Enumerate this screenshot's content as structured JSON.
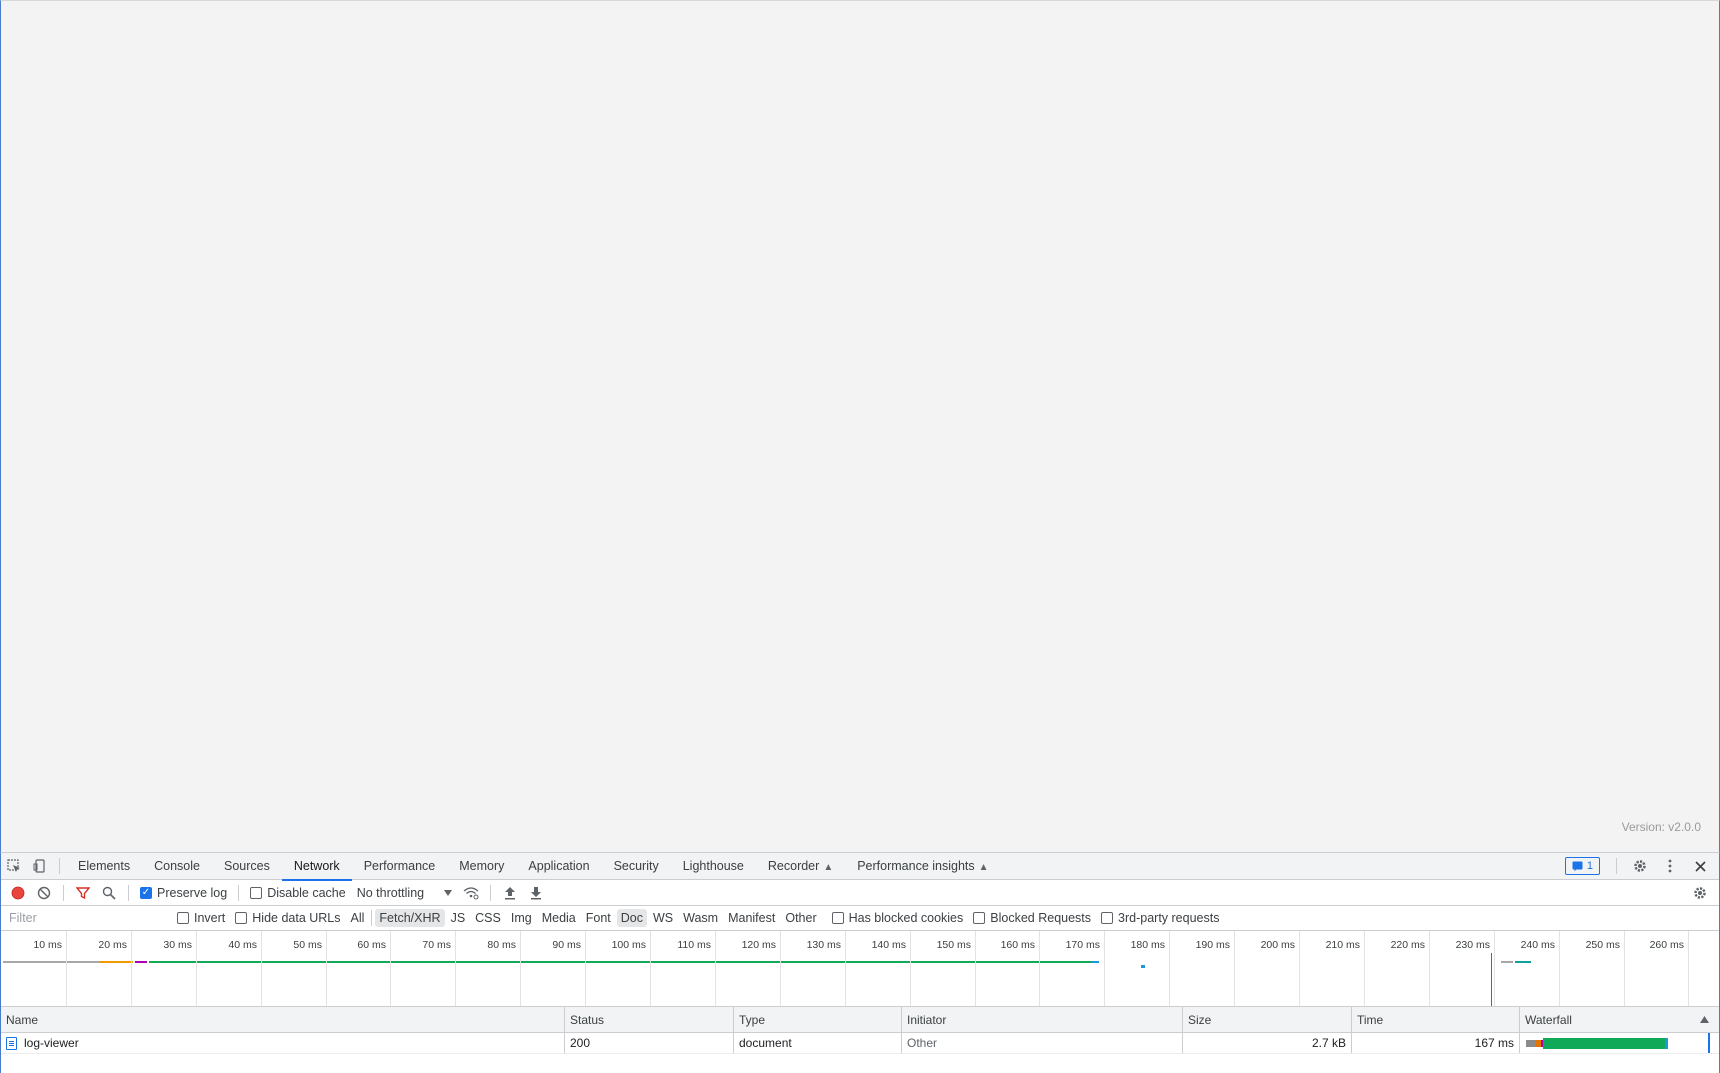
{
  "page": {
    "version": "Version: v2.0.0"
  },
  "devtools": {
    "tabs": [
      "Elements",
      "Console",
      "Sources",
      "Network",
      "Performance",
      "Memory",
      "Application",
      "Security",
      "Lighthouse",
      "Recorder",
      "Performance insights"
    ],
    "active_tab": "Network",
    "issues_count": "1"
  },
  "toolbar": {
    "preserve_log": "Preserve log",
    "disable_cache": "Disable cache",
    "throttling": "No throttling"
  },
  "filter": {
    "placeholder": "Filter",
    "invert": "Invert",
    "hide_data_urls": "Hide data URLs",
    "types": [
      "All",
      "Fetch/XHR",
      "JS",
      "CSS",
      "Img",
      "Media",
      "Font",
      "Doc",
      "WS",
      "Wasm",
      "Manifest",
      "Other"
    ],
    "selected_types": [
      "Fetch/XHR",
      "Doc"
    ],
    "has_blocked_cookies": "Has blocked cookies",
    "blocked_requests": "Blocked Requests",
    "third_party": "3rd-party requests"
  },
  "overview": {
    "ticks": [
      "10 ms",
      "20 ms",
      "30 ms",
      "40 ms",
      "50 ms",
      "60 ms",
      "70 ms",
      "80 ms",
      "90 ms",
      "100 ms",
      "110 ms",
      "120 ms",
      "130 ms",
      "140 ms",
      "150 ms",
      "160 ms",
      "170 ms",
      "180 ms",
      "190 ms",
      "200 ms",
      "210 ms",
      "220 ms",
      "230 ms",
      "240 ms",
      "250 ms",
      "260 ms"
    ]
  },
  "grid": {
    "headers": {
      "name": "Name",
      "status": "Status",
      "type": "Type",
      "initiator": "Initiator",
      "size": "Size",
      "time": "Time",
      "waterfall": "Waterfall"
    },
    "rows": [
      {
        "name": "log-viewer",
        "status": "200",
        "type": "document",
        "initiator": "Other",
        "size": "2.7 kB",
        "time": "167 ms"
      }
    ]
  },
  "colors": {
    "accent": "#1a73e8",
    "record": "#e8453c",
    "waterfall_green": "#0fa958"
  }
}
